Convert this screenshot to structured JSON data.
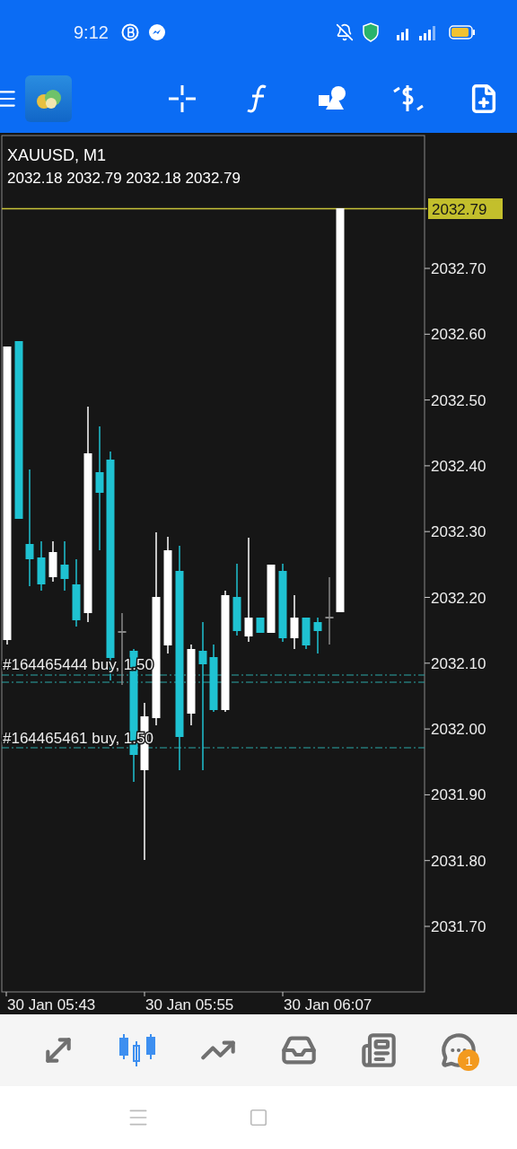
{
  "status_bar": {
    "time": "9:12"
  },
  "chart": {
    "title": "XAUUSD, M1",
    "ohlc": "2032.18 2032.79 2032.18 2032.79",
    "current_price": "2032.79",
    "price_labels": [
      "2032.70",
      "2032.60",
      "2032.50",
      "2032.40",
      "2032.30",
      "2032.20",
      "2032.10",
      "2032.00",
      "2031.90",
      "2031.80",
      "2031.70"
    ],
    "time_labels": [
      "30 Jan 05:43",
      "30 Jan 05:55",
      "30 Jan 06:07"
    ],
    "orders": [
      {
        "label": "#164465444 buy, 1.50"
      },
      {
        "label": "#164465461 buy, 1.50"
      }
    ]
  },
  "bottom_nav": {
    "items": [
      {
        "selected": false
      },
      {
        "selected": true
      },
      {
        "selected": false
      },
      {
        "selected": false
      },
      {
        "selected": false
      },
      {
        "selected": false,
        "badge": "1"
      }
    ]
  }
}
